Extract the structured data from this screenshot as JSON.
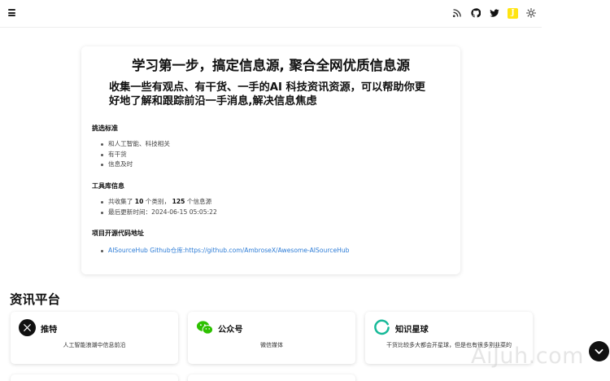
{
  "topbar": {
    "icons": [
      "menu-icon",
      "rss-icon",
      "github-icon",
      "twitter-icon",
      "jike-icon",
      "sun-icon"
    ],
    "jike_glyph": "J"
  },
  "intro": {
    "title": "学习第一步，搞定信息源, 聚合全网优质信息源",
    "subtitle": "收集一些有观点、有干货、一手的AI 科技资讯资源，可以帮助你更好地了解和跟踪前沿一手消息,解决信息焦虑",
    "criteria": {
      "heading": "挑选标准",
      "items": [
        "和人工智能、科技相关",
        "有干货",
        "信息及时"
      ]
    },
    "library": {
      "heading": "工具库信息",
      "stat_prefix": "共收集了",
      "category_count": "10",
      "stat_mid1": "个类别，",
      "source_count": "125",
      "stat_suffix": "个信息源",
      "updated": "最后更新时间：2024-06-15 05:05:22"
    },
    "repo": {
      "heading": "项目开源代码地址",
      "link": "AISourceHub Github仓库:https://github.com/AmbroseX/Awesome-AISourceHub"
    }
  },
  "platforms": {
    "heading": "资讯平台",
    "cards": [
      {
        "name": "推特",
        "desc": "人工智能浪潮中信息前沿",
        "icon": "x-icon",
        "color": "#111111"
      },
      {
        "name": "公众号",
        "desc": "微信媒体",
        "icon": "wechat-icon",
        "color": "#2dc100"
      },
      {
        "name": "知识星球",
        "desc": "干货比较多大都会开星球，但是也有很多割韭菜的",
        "icon": "zsxq-icon",
        "color": "#16b998"
      }
    ]
  },
  "watermark": "AiJuh.com"
}
